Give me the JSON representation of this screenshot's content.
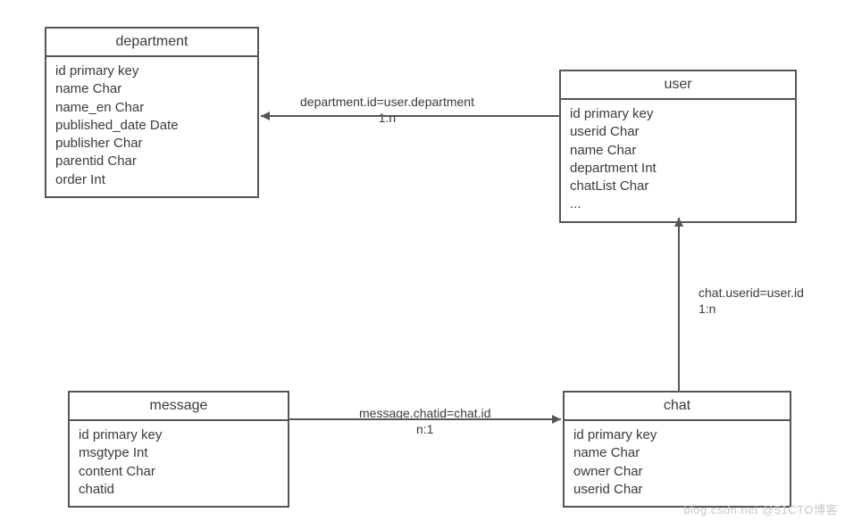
{
  "entities": {
    "department": {
      "title": "department",
      "fields": [
        "id primary key",
        "name Char",
        "name_en Char",
        "published_date Date",
        "publisher Char",
        "parentid  Char",
        "order Int"
      ]
    },
    "user": {
      "title": "user",
      "fields": [
        "id primary key",
        "userid Char",
        "name Char",
        "department Int",
        "chatList Char",
        "..."
      ]
    },
    "message": {
      "title": "message",
      "fields": [
        "id primary key",
        "msgtype Int",
        "content Char",
        "chatid"
      ]
    },
    "chat": {
      "title": "chat",
      "fields": [
        "id primary key",
        "name Char",
        "owner Char",
        "userid Char"
      ]
    }
  },
  "relations": {
    "dept_user": {
      "text": "department.id=user.department",
      "card": "1:n"
    },
    "msg_chat": {
      "text": "message.chatid=chat.id",
      "card": "n:1"
    },
    "chat_user": {
      "text": "chat.userid=user.id",
      "card": "1:n"
    }
  },
  "watermark": "blog.csdn.net @51CTO博客"
}
